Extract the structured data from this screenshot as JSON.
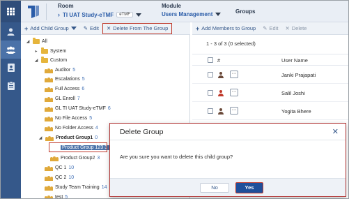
{
  "header": {
    "room_label": "Room",
    "room_value": "TI UAT Study-eTMF",
    "room_tag": "eTMF",
    "module_label": "Module",
    "module_value": "Users Management",
    "page_title": "Groups"
  },
  "left_toolbar": {
    "add_child_group": "Add Child Group",
    "edit": "Edit",
    "delete_from_group": "Delete From The Group"
  },
  "right_toolbar": {
    "add_members": "Add Members to Group",
    "edit": "Edit",
    "delete": "Delete"
  },
  "tree": {
    "all": "All",
    "system": "System",
    "custom": "Custom",
    "items": [
      {
        "label": "Auditor",
        "count": "5"
      },
      {
        "label": "Escalations",
        "count": "5"
      },
      {
        "label": "Full Access",
        "count": "6"
      },
      {
        "label": "GL Enroll",
        "count": "7"
      },
      {
        "label": "GL TI UAT Study-eTMF",
        "count": "6"
      },
      {
        "label": "No File Access",
        "count": "5"
      },
      {
        "label": "No Folder Access",
        "count": "4"
      }
    ],
    "product_group1": {
      "label": "Product Group1",
      "count": "0"
    },
    "product_group_123": {
      "label": "Product Group 123",
      "count": "3"
    },
    "product_group2": {
      "label": "Product Group2",
      "count": "3"
    },
    "tail_items": [
      {
        "label": "QC 1",
        "count": "10"
      },
      {
        "label": "QC 2",
        "count": "10"
      },
      {
        "label": "Study Team Training",
        "count": "14"
      },
      {
        "label": "test",
        "count": "5"
      }
    ]
  },
  "list": {
    "selection_text": "1 - 3 of 3 (0 selected)",
    "col_hash": "#",
    "col_user": "User Name",
    "rows": [
      {
        "name": "Janki Prajapati",
        "person_color": "#6b4a3a"
      },
      {
        "name": "Salil Joshi",
        "person_color": "#c0392b"
      },
      {
        "name": "Yogita Bhere",
        "person_color": "#6b4a3a"
      }
    ]
  },
  "modal": {
    "title": "Delete Group",
    "close": "✕",
    "message": "Are you sure you want to delete this child group?",
    "no": "No",
    "yes": "Yes"
  },
  "colors": {
    "rail": "#35588a",
    "accent": "#1f4f9a",
    "highlight_border": "#c0392b",
    "selected_row": "#4b72a8"
  }
}
